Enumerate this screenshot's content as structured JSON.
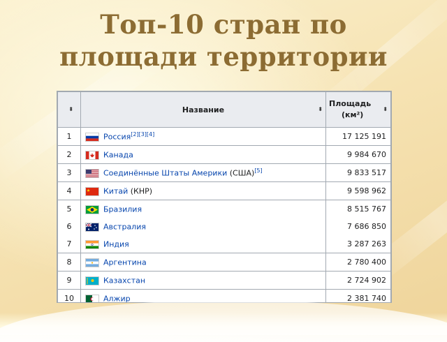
{
  "slide": {
    "title_line1": "Топ-10 стран по",
    "title_line2": "площади территории"
  },
  "table": {
    "headers": {
      "name": "Название",
      "area_line1": "Площадь",
      "area_line2": "(км²)"
    },
    "rows": [
      {
        "rank": "1",
        "name": "Россия",
        "suffix": "",
        "refs": "[2][3][4]",
        "area": "17 125 191",
        "flag": "russia-flag-icon"
      },
      {
        "rank": "2",
        "name": "Канада",
        "suffix": "",
        "refs": "",
        "area": "9 984 670",
        "flag": "canada-flag-icon"
      },
      {
        "rank": "3",
        "name": "Соединённые Штаты Америки",
        "suffix": " (США)",
        "refs": "[5]",
        "area": "9 833 517",
        "flag": "usa-flag-icon"
      },
      {
        "rank": "4",
        "name": "Китай",
        "suffix": " (КНР)",
        "refs": "",
        "area": "9 598 962",
        "flag": "china-flag-icon"
      },
      {
        "rank": "5",
        "name": "Бразилия",
        "suffix": "",
        "refs": "",
        "area": "8 515 767",
        "flag": "brazil-flag-icon"
      },
      {
        "rank": "6",
        "name": "Австралия",
        "suffix": "",
        "refs": "",
        "area": "7 686 850",
        "flag": "australia-flag-icon"
      },
      {
        "rank": "7",
        "name": "Индия",
        "suffix": "",
        "refs": "",
        "area": "3 287 263",
        "flag": "india-flag-icon"
      },
      {
        "rank": "8",
        "name": "Аргентина",
        "suffix": "",
        "refs": "",
        "area": "2 780 400",
        "flag": "argentina-flag-icon"
      },
      {
        "rank": "9",
        "name": "Казахстан",
        "suffix": "",
        "refs": "",
        "area": "2 724 902",
        "flag": "kazakhstan-flag-icon"
      },
      {
        "rank": "10",
        "name": "Алжир",
        "suffix": "",
        "refs": "",
        "area": "2 381 740",
        "flag": "algeria-flag-icon"
      }
    ]
  },
  "colors": {
    "title": "#8c6c33",
    "link": "#0645ad",
    "header_bg": "#eaecf0",
    "border": "#a2a9b1"
  }
}
